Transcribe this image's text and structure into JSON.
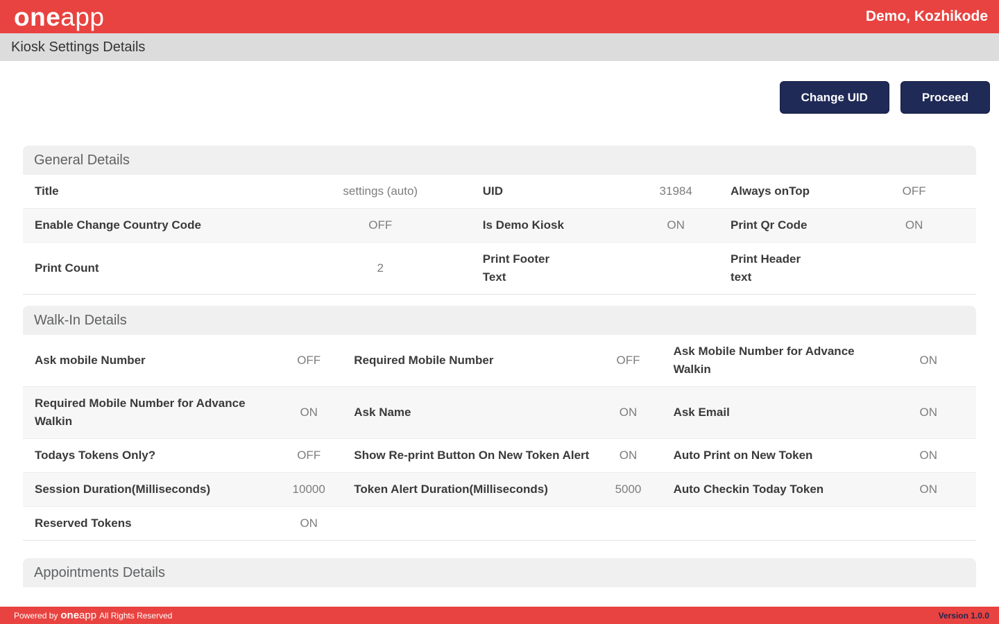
{
  "app": {
    "logo_bold": "one",
    "logo_light": "app",
    "location": "Demo, Kozhikode",
    "page_title": "Kiosk Settings Details",
    "colors": {
      "brand_red": "#e84340",
      "button_navy": "#1f2a57"
    }
  },
  "toolbar": {
    "change_uid_label": "Change UID",
    "proceed_label": "Proceed"
  },
  "general": {
    "title": "General Details",
    "rows": [
      {
        "c": [
          {
            "l": "Title",
            "v": "settings (auto)"
          },
          {
            "l": "UID",
            "v": "31984"
          },
          {
            "l": "Always onTop",
            "v": "OFF"
          }
        ]
      },
      {
        "c": [
          {
            "l": "Enable Change Country Code",
            "v": "OFF"
          },
          {
            "l": "Is Demo Kiosk",
            "v": "ON"
          },
          {
            "l": "Print Qr Code",
            "v": "ON"
          }
        ]
      },
      {
        "c": [
          {
            "l": "Print Count",
            "v": "2"
          },
          {
            "l": "Print Footer Text",
            "v": ""
          },
          {
            "l": "Print Header text",
            "v": ""
          }
        ]
      }
    ]
  },
  "walkin": {
    "title": "Walk-In Details",
    "rows": [
      {
        "c": [
          {
            "l": "Ask mobile Number",
            "v": "OFF"
          },
          {
            "l": "Required Mobile Number",
            "v": "OFF"
          },
          {
            "l": "Ask Mobile Number for Advance Walkin",
            "v": "ON"
          }
        ]
      },
      {
        "c": [
          {
            "l": "Required Mobile Number for Advance Walkin",
            "v": "ON"
          },
          {
            "l": "Ask Name",
            "v": "ON"
          },
          {
            "l": "Ask Email",
            "v": "ON"
          }
        ]
      },
      {
        "c": [
          {
            "l": "Todays Tokens Only?",
            "v": "OFF"
          },
          {
            "l": "Show Re-print Button On New Token Alert",
            "v": "ON"
          },
          {
            "l": "Auto Print on New Token",
            "v": "ON"
          }
        ]
      },
      {
        "c": [
          {
            "l": "Session Duration(Milliseconds)",
            "v": "10000"
          },
          {
            "l": "Token Alert Duration(Milliseconds)",
            "v": "5000"
          },
          {
            "l": "Auto Checkin Today Token",
            "v": "ON"
          }
        ]
      },
      {
        "c": [
          {
            "l": "Reserved Tokens",
            "v": "ON"
          }
        ]
      }
    ]
  },
  "appointments": {
    "title": "Appointments Details"
  },
  "footer": {
    "powered_prefix": "Powered by",
    "logo_bold": "one",
    "logo_light": "app",
    "rights": "All Rights Reserved",
    "version": "Version 1.0.0"
  }
}
